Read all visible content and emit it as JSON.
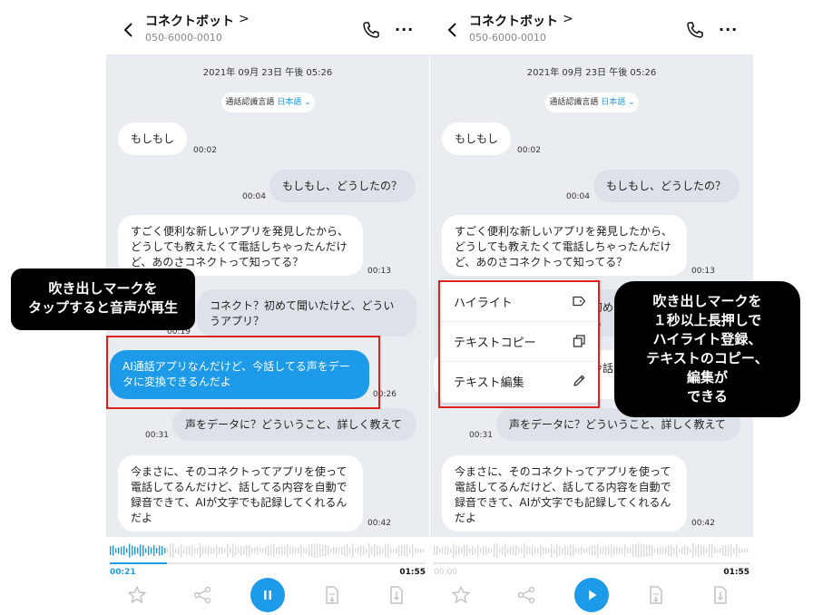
{
  "app": {
    "contact_name": "コネクトボット",
    "title_arrow": ">",
    "phone_number": "050-6000-0010"
  },
  "chat": {
    "date": "2021年 09月 23日 午後 05:26",
    "language_label": "通話認識言語",
    "language_value": "日本語",
    "messages": [
      {
        "text": "もしもし",
        "time": "00:02",
        "speaker": "other"
      },
      {
        "text": "もしもし、どうしたの？",
        "time": "00:04",
        "speaker": "me"
      },
      {
        "text": "すごく便利な新しいアプリを発見したから、どうしても教えたくて電話しちゃったんだけど、あのさコネクトって知ってる？",
        "time": "00:13",
        "speaker": "other"
      },
      {
        "text": "コネクト？初めて聞いたけど、どういうアプリ？",
        "time": "00:19",
        "speaker": "me"
      },
      {
        "text": "AI通話アプリなんだけど、今話してる声をデータに変換できるんだよ",
        "time": "00:26",
        "speaker": "other"
      },
      {
        "text": "声をデータに？どういうこと、詳しく教えて",
        "time": "00:31",
        "speaker": "me"
      },
      {
        "text": "今まさに、そのコネクトってアプリを使って電話してるんだけど、話してる内容を自動で録音できて、AIが文字でも記録してくれるんだよ",
        "time": "00:42",
        "speaker": "other"
      }
    ],
    "partial_right_1": "初め",
    "partial_right_2": "う",
    "partial_right_3": "今話"
  },
  "player": {
    "current_time_left": "00:21",
    "current_time_right": "00:00",
    "total_time": "01:55",
    "progress_left": 0.18,
    "progress_right": 0.0,
    "accent_color": "#1e9be8"
  },
  "context_menu": {
    "items": [
      {
        "label": "ハイライト",
        "icon": "tag-icon"
      },
      {
        "label": "テキストコピー",
        "icon": "copy-icon"
      },
      {
        "label": "テキスト編集",
        "icon": "pencil-icon"
      }
    ]
  },
  "annotations": {
    "left_line1": "吹き出しマークを",
    "left_line2": "タップすると音声が再生",
    "right_line1": "吹き出しマークを",
    "right_line2": "１秒以上長押しで",
    "right_line3": "ハイライト登録、",
    "right_line4": "テキストのコピー、",
    "right_line5": "編集が",
    "right_line6": "できる"
  }
}
